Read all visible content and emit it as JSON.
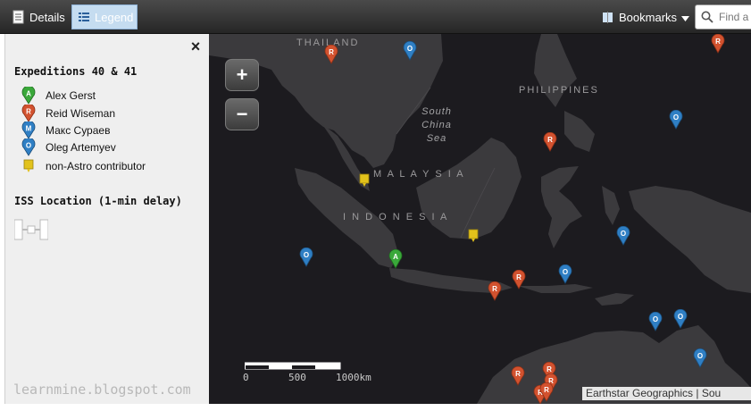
{
  "toolbar": {
    "details_label": "Details",
    "legend_label": "Legend",
    "bookmarks_label": "Bookmarks",
    "search_placeholder": "Find a"
  },
  "legend": {
    "close_glyph": "×",
    "title": "Expeditions 40 & 41",
    "items": [
      {
        "letter": "A",
        "label": "Alex Gerst",
        "color": "#3aa83a"
      },
      {
        "letter": "R",
        "label": "Reid Wiseman",
        "color": "#d2522f"
      },
      {
        "letter": "M",
        "label": "Макс Сураев",
        "color": "#2f7fc4"
      },
      {
        "letter": "O",
        "label": "Oleg Artemyev",
        "color": "#2f7fc4"
      },
      {
        "letter": "",
        "label": "non-Astro contributor",
        "color": "#e2c21b"
      }
    ],
    "iss_title": "ISS Location (1-min delay)",
    "watermark": "learnmine.blogspot.com"
  },
  "map": {
    "zoom_in": "+",
    "zoom_out": "−",
    "places": {
      "thailand": "THAILAND",
      "philippines": "PHILIPPINES",
      "malaysia": "M A L A Y S I A",
      "indonesia": "I N D O N E S I A",
      "sea_1": "South",
      "sea_2": "China",
      "sea_3": "Sea"
    },
    "scale": {
      "zero": "0",
      "mid": "500",
      "end": "1000km"
    },
    "attribution": "Earthstar Geographics | Sou",
    "pins": [
      {
        "letter": "R",
        "color": "#d2522f"
      },
      {
        "letter": "O",
        "color": "#2f7fc4"
      },
      {
        "letter": "R",
        "color": "#d2522f"
      },
      {
        "letter": "O",
        "color": "#2f7fc4"
      },
      {
        "letter": "R",
        "color": "#d2522f"
      },
      {
        "letter": "",
        "color": "#e2c21b"
      },
      {
        "letter": "",
        "color": "#e2c21b"
      },
      {
        "letter": "O",
        "color": "#2f7fc4"
      },
      {
        "letter": "O",
        "color": "#2f7fc4"
      },
      {
        "letter": "A",
        "color": "#3aa83a"
      },
      {
        "letter": "R",
        "color": "#d2522f"
      },
      {
        "letter": "R",
        "color": "#d2522f"
      },
      {
        "letter": "O",
        "color": "#2f7fc4"
      },
      {
        "letter": "O",
        "color": "#2f7fc4"
      },
      {
        "letter": "O",
        "color": "#2f7fc4"
      },
      {
        "letter": "O",
        "color": "#2f7fc4"
      },
      {
        "letter": "R",
        "color": "#d2522f"
      },
      {
        "letter": "R",
        "color": "#d2522f"
      },
      {
        "letter": "R",
        "color": "#d2522f"
      },
      {
        "letter": "R",
        "color": "#d2522f"
      },
      {
        "letter": "R",
        "color": "#d2522f"
      }
    ]
  }
}
